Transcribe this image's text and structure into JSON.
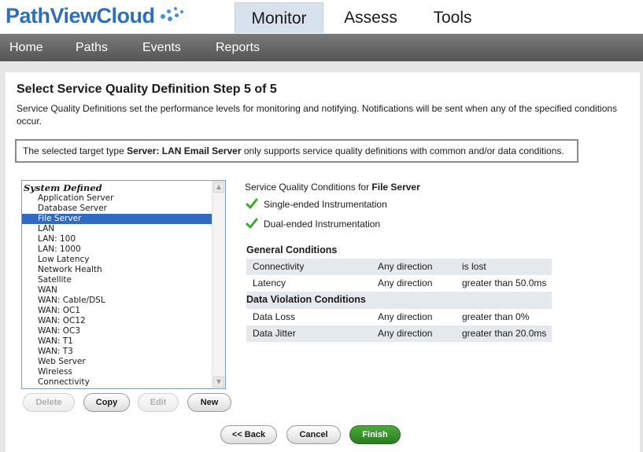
{
  "app": {
    "logo_text": "PathViewCloud",
    "top_tabs": [
      {
        "label": "Monitor",
        "active": true
      },
      {
        "label": "Assess",
        "active": false
      },
      {
        "label": "Tools",
        "active": false
      }
    ],
    "nav": [
      "Home",
      "Paths",
      "Events",
      "Reports"
    ]
  },
  "page": {
    "title": "Select Service Quality Definition Step 5 of 5",
    "description": "Service Quality Definitions set the performance levels for monitoring and notifying. Notifications will be sent when any of the specified conditions occur.",
    "notice_prefix": "The selected target type ",
    "notice_target": "Server: LAN Email Server",
    "notice_suffix": " only supports service quality definitions with common and/or data conditions."
  },
  "list": {
    "header": "System Defined",
    "items": [
      "Application Server",
      "Database Server",
      "File Server",
      "LAN",
      "LAN: 100",
      "LAN: 1000",
      "Low Latency",
      "Network Health",
      "Satellite",
      "WAN",
      "WAN: Cable/DSL",
      "WAN: OC1",
      "WAN: OC12",
      "WAN: OC3",
      "WAN: T1",
      "WAN: T3",
      "Web Server",
      "Wireless",
      "Connectivity"
    ],
    "selected_index": 2,
    "buttons": {
      "delete": "Delete",
      "copy": "Copy",
      "edit": "Edit",
      "new": "New"
    }
  },
  "conditions": {
    "title_prefix": "Service Quality Conditions for ",
    "title_target": "File Server",
    "instrumentation": [
      "Single-ended Instrumentation",
      "Dual-ended Instrumentation"
    ],
    "general_header": "General Conditions",
    "general_rows": [
      {
        "metric": "Connectivity",
        "direction": "Any direction",
        "condition": "is lost"
      },
      {
        "metric": "Latency",
        "direction": "Any direction",
        "condition": "greater than 50.0ms"
      }
    ],
    "data_header": "Data Violation Conditions",
    "data_rows": [
      {
        "metric": "Data Loss",
        "direction": "Any direction",
        "condition": "greater than 0%"
      },
      {
        "metric": "Data Jitter",
        "direction": "Any direction",
        "condition": "greater than 20.0ms"
      }
    ]
  },
  "footer": {
    "back": "<< Back",
    "cancel": "Cancel",
    "finish": "Finish"
  },
  "colors": {
    "accent": "#2f6fb5",
    "selection": "#316ac5",
    "finish": "#2a7c1e",
    "check": "#3aa82a"
  },
  "icons": {
    "check": "check-icon",
    "logo_dots": "logo-dots-icon"
  }
}
